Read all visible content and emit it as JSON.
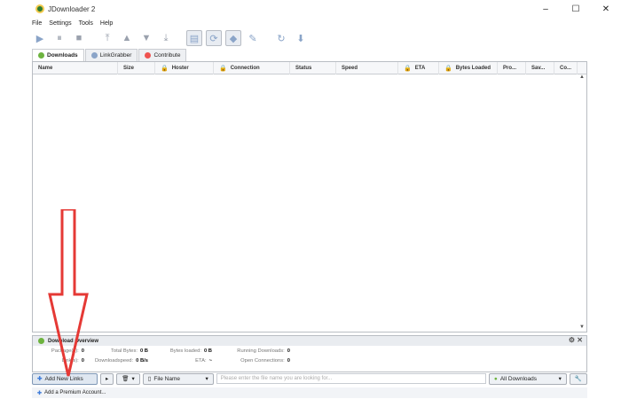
{
  "window": {
    "title": "JDownloader 2",
    "controls": [
      "–",
      "☐",
      "✕"
    ]
  },
  "menu": [
    "File",
    "Settings",
    "Tools",
    "Help"
  ],
  "tabs": [
    {
      "label": "Downloads",
      "active": true,
      "color": "#6db33f"
    },
    {
      "label": "LinkGrabber",
      "active": false,
      "color": "#8aa4c8"
    },
    {
      "label": "Contribute",
      "active": false,
      "color": "#ef5350"
    }
  ],
  "table": {
    "columns": [
      {
        "label": "Name",
        "width": 96,
        "lock": false
      },
      {
        "label": "Size",
        "width": 42,
        "lock": false
      },
      {
        "label": "Hoster",
        "width": 66,
        "lock": true
      },
      {
        "label": "Connection",
        "width": 86,
        "lock": true
      },
      {
        "label": "Status",
        "width": 52,
        "lock": false
      },
      {
        "label": "Speed",
        "width": 70,
        "lock": false
      },
      {
        "label": "ETA",
        "width": 46,
        "lock": true
      },
      {
        "label": "Bytes Loaded",
        "width": 66,
        "lock": true
      },
      {
        "label": "Pro...",
        "width": 32,
        "lock": false
      },
      {
        "label": "Sav...",
        "width": 32,
        "lock": false
      },
      {
        "label": "Co...",
        "width": 26,
        "lock": false
      }
    ]
  },
  "overview": {
    "title": "Download Overview",
    "row1": [
      {
        "label": "Package(s):",
        "value": "0"
      },
      {
        "label": "Total Bytes:",
        "value": "0 B"
      },
      {
        "label": "Bytes loaded:",
        "value": "0 B"
      },
      {
        "label": "Running Downloads:",
        "value": "0"
      }
    ],
    "row2": [
      {
        "label": "Link(s):",
        "value": "0"
      },
      {
        "label": "Downloadspeed:",
        "value": "0 B/s"
      },
      {
        "label": "ETA:",
        "value": "~"
      },
      {
        "label": "Open Connections:",
        "value": "0"
      }
    ]
  },
  "bottom": {
    "add_links": "Add New Links",
    "file_name": "File Name",
    "search_placeholder": "Please enter the file name you are looking for...",
    "all_downloads": "All Downloads"
  },
  "status": {
    "premium": "Add a Premium Account..."
  },
  "colors": {
    "accent": "#6db33f",
    "arrow": "#e53935"
  }
}
